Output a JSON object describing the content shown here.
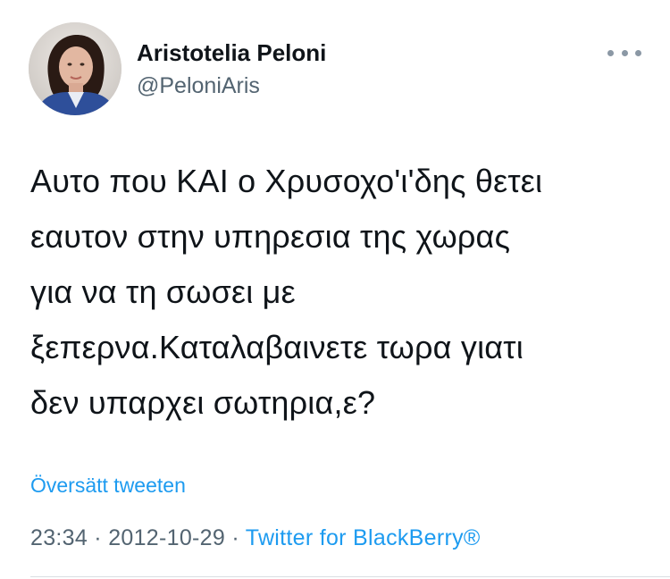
{
  "author": {
    "display_name": "Aristotelia Peloni",
    "handle": "@PeloniAris"
  },
  "more_options_icon": "ellipsis-icon",
  "tweet": {
    "lines": [
      "Αυτο που ΚΑΙ ο Χρυσοχο'ι'δης θετει",
      "εαυτον στην υπηρεσια της χωρας",
      "για να τη σωσει με",
      "ξεπερνα.Καταλαβαινετε τωρα γιατι",
      "δεν υπαρχει σωτηρια,ε?"
    ]
  },
  "translate_label": "Översätt tweeten",
  "meta": {
    "time": "23:34",
    "separator1": " · ",
    "date": "2012-10-29",
    "separator2": " · ",
    "source": "Twitter for BlackBerry®"
  },
  "colors": {
    "link": "#1d9bf0",
    "text": "#0f1419",
    "secondary": "#536471"
  }
}
